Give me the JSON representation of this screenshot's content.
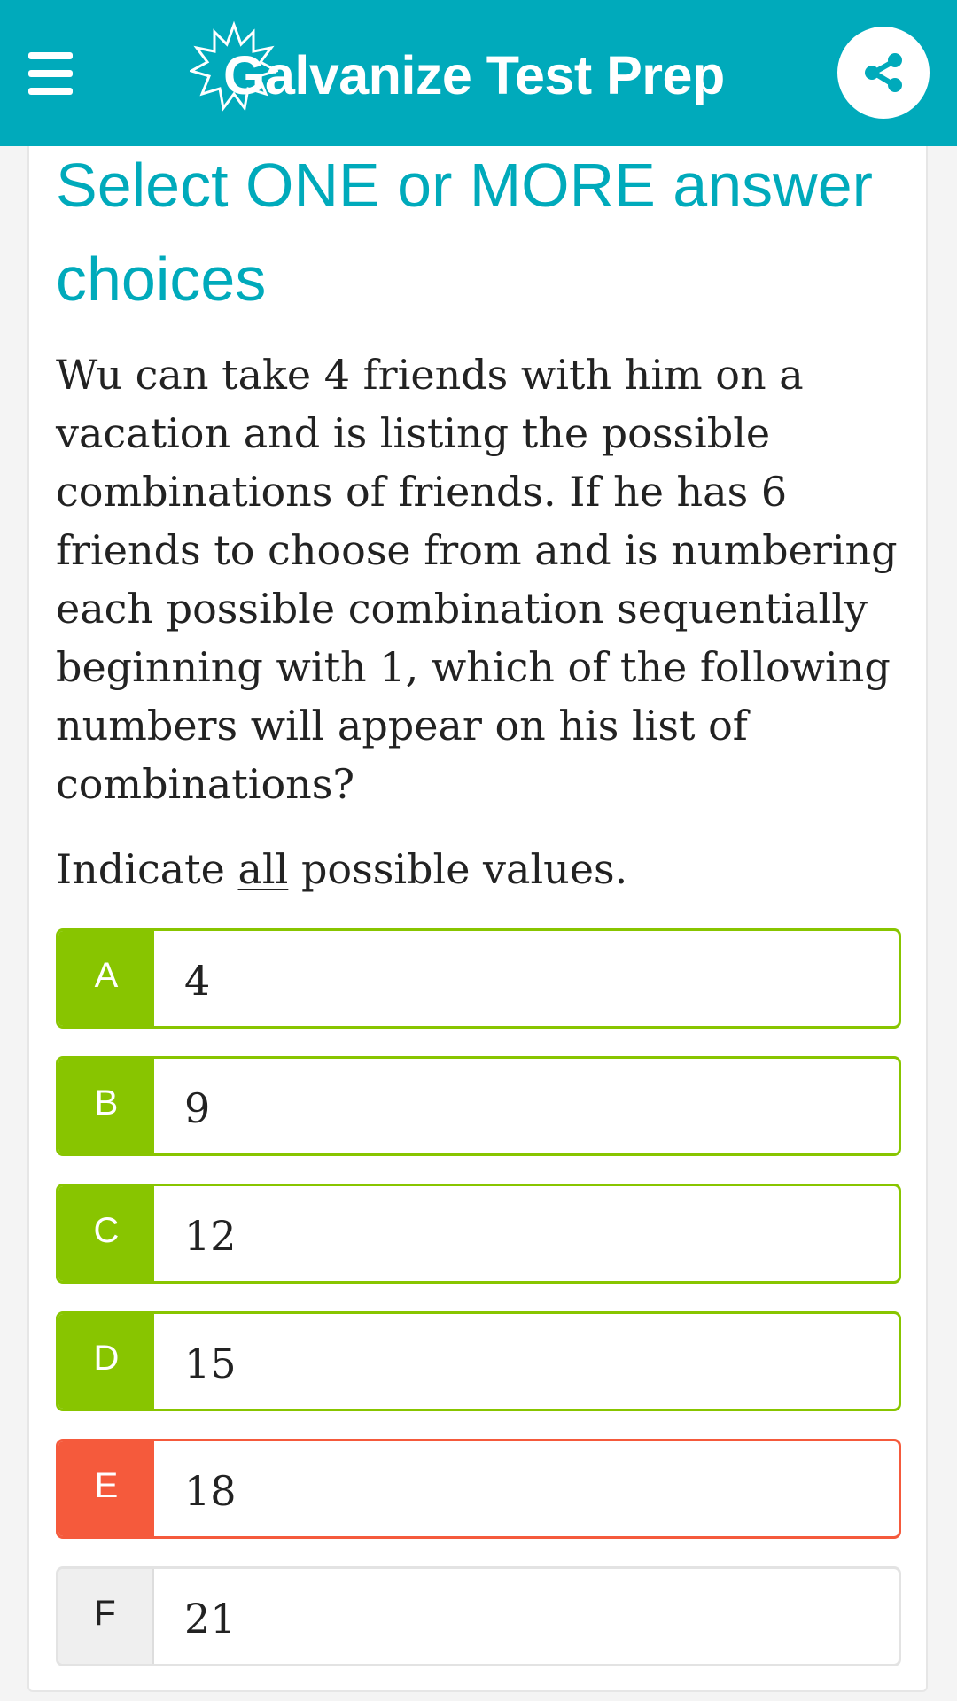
{
  "header": {
    "app_title": "Galvanize Test Prep",
    "logo_letter": "G",
    "logo_rest": "alvanize Test Prep",
    "colors": {
      "brand": "#00aabb",
      "correct": "#88c500",
      "wrong": "#f55a3c",
      "neutral": "#efefef"
    },
    "icons": {
      "menu": "hamburger-menu-icon",
      "share": "share-icon",
      "logo": "sunburst-logo-icon"
    }
  },
  "question": {
    "instruction": "Select ONE or MORE answer choices",
    "text": "Wu can take 4 friends with him on a vacation and is listing the possible combinations of friends. If he has 6 friends to choose from and is numbering each possible combination sequentially beginning with 1, which of the following numbers will appear on his list of combinations?",
    "indicate_prefix": "Indicate ",
    "indicate_emphasis": "all",
    "indicate_suffix": " possible values."
  },
  "choices": [
    {
      "letter": "A",
      "value": "4",
      "state": "correct"
    },
    {
      "letter": "B",
      "value": "9",
      "state": "correct"
    },
    {
      "letter": "C",
      "value": "12",
      "state": "correct"
    },
    {
      "letter": "D",
      "value": "15",
      "state": "correct"
    },
    {
      "letter": "E",
      "value": "18",
      "state": "wrong"
    },
    {
      "letter": "F",
      "value": "21",
      "state": "unselected"
    }
  ]
}
